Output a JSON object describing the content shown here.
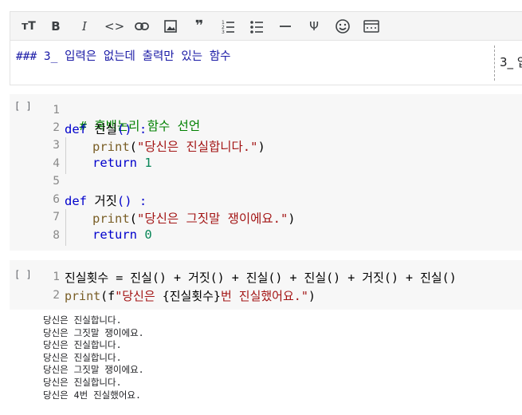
{
  "toolbar": {
    "icons": [
      "text-size-icon",
      "bold-icon",
      "italic-icon",
      "code-icon",
      "link-icon",
      "image-icon",
      "quote-icon",
      "numbered-list-icon",
      "bulleted-list-icon",
      "horizontal-rule-icon",
      "psi-icon",
      "emoji-icon",
      "more-icon"
    ]
  },
  "markdown_cell": {
    "source": "### 3_ 입력은 없는데 출력만 있는 함수",
    "preview": "3_ 입"
  },
  "code_cell_1": {
    "run_marker": "[ ]",
    "line_numbers": [
      "1",
      "2",
      "3",
      "4",
      "5",
      "6",
      "7",
      "8"
    ],
    "lines": {
      "l1": "# 흑백논리 함수 선언",
      "l2_kw": "def",
      "l2_name": " 진실",
      "l2_rest": "() :",
      "l3_fn": "print",
      "l3_open": "(",
      "l3_str": "\"당신은 진실합니다.\"",
      "l3_close": ")",
      "l4_kw": "return",
      "l4_num": " 1",
      "l6_kw": "def",
      "l6_name": " 거짓",
      "l6_rest": "() :",
      "l7_fn": "print",
      "l7_open": "(",
      "l7_str": "\"당신은 그짓말 쟁이에요.\"",
      "l7_close": ")",
      "l8_kw": "return",
      "l8_num": " 0"
    }
  },
  "code_cell_2": {
    "run_marker": "[ ]",
    "line_numbers": [
      "1",
      "2"
    ],
    "line1": "진실횟수 = 진실() + 거짓() + 진실() + 진실() + 거짓() + 진실()",
    "line2_fn": "print",
    "line2_open": "(f",
    "line2_str_a": "\"당신은 ",
    "line2_var": "{진실횟수}",
    "line2_str_b": "번 진실했어요.\"",
    "line2_close": ")"
  },
  "output": {
    "lines": [
      "당신은 진실합니다.",
      "당신은 그짓말 쟁이에요.",
      "당신은 진실합니다.",
      "당신은 진실합니다.",
      "당신은 그짓말 쟁이에요.",
      "당신은 진실합니다.",
      "당신은 4번 진실했어요."
    ]
  }
}
